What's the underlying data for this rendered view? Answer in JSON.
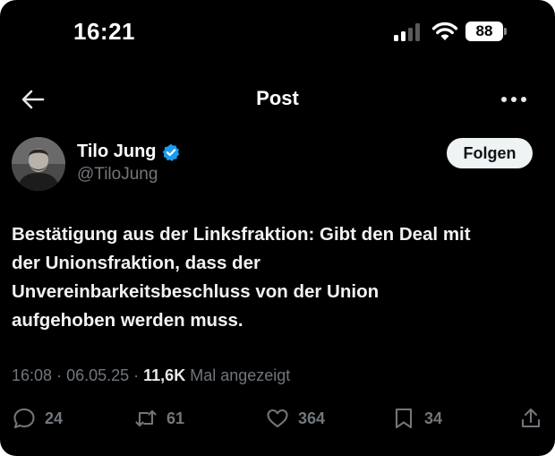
{
  "status_bar": {
    "time": "16:21",
    "battery": "88",
    "icons": [
      "cellular-signal-icon",
      "wifi-icon",
      "battery-icon"
    ]
  },
  "nav": {
    "title": "Post",
    "back_icon": "arrow-left-icon",
    "more_icon": "more-horizontal-icon"
  },
  "author": {
    "name": "Tilo Jung",
    "handle": "@TiloJung",
    "verified": true,
    "follow_label": "Folgen"
  },
  "post": {
    "lines": [
      "Bestätigung aus der Linksfraktion: Gibt den Deal mit",
      "der Unionsfraktion, dass der",
      "Unvereinbarkeitsbeschluss von der Union",
      "aufgehoben werden muss."
    ],
    "time": "16:08",
    "date": "06.05.25",
    "views": "11,6K",
    "views_label": "Mal angezeigt"
  },
  "actions": {
    "replies": "24",
    "reposts": "61",
    "likes": "364",
    "bookmarks": "34"
  },
  "colors": {
    "background": "#000000",
    "text": "#e7e9ea",
    "secondary": "#71767b",
    "verified": "#1d9bf0"
  }
}
